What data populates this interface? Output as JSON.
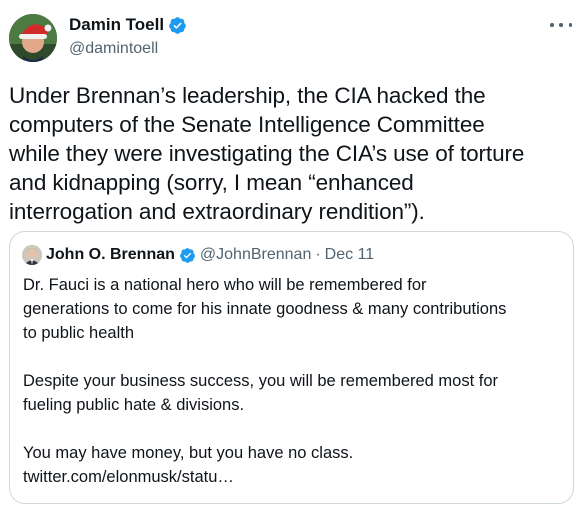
{
  "author": {
    "name": "Damin Toell",
    "handle": "@damintoell"
  },
  "tweet": {
    "lines": [
      "Under Brennan’s leadership, the CIA hacked the",
      "computers of the Senate Intelligence Committee",
      "while they were investigating the CIA’s use of torture",
      "and kidnapping (sorry, I mean “enhanced",
      "interrogation and extraordinary rendition”)."
    ]
  },
  "quote": {
    "name": "John O. Brennan",
    "handle": "@JohnBrennan",
    "separator": "·",
    "date": "Dec 11",
    "para1": [
      "Dr. Fauci is a national hero who will be remembered for",
      "generations to come for his innate goodness & many contributions",
      "to public health"
    ],
    "para2": [
      "Despite your business success, you will be remembered most for",
      "fueling public hate & divisions."
    ],
    "para3": [
      "You may have money, but you have no class.",
      "twitter.com/elonmusk/statu…"
    ]
  },
  "colors": {
    "verified": "#1d9bf0",
    "secondary_text": "#536471",
    "border": "#cfd9de"
  },
  "icons": {
    "verified": "verified-badge-icon",
    "more": "more-options-icon"
  }
}
